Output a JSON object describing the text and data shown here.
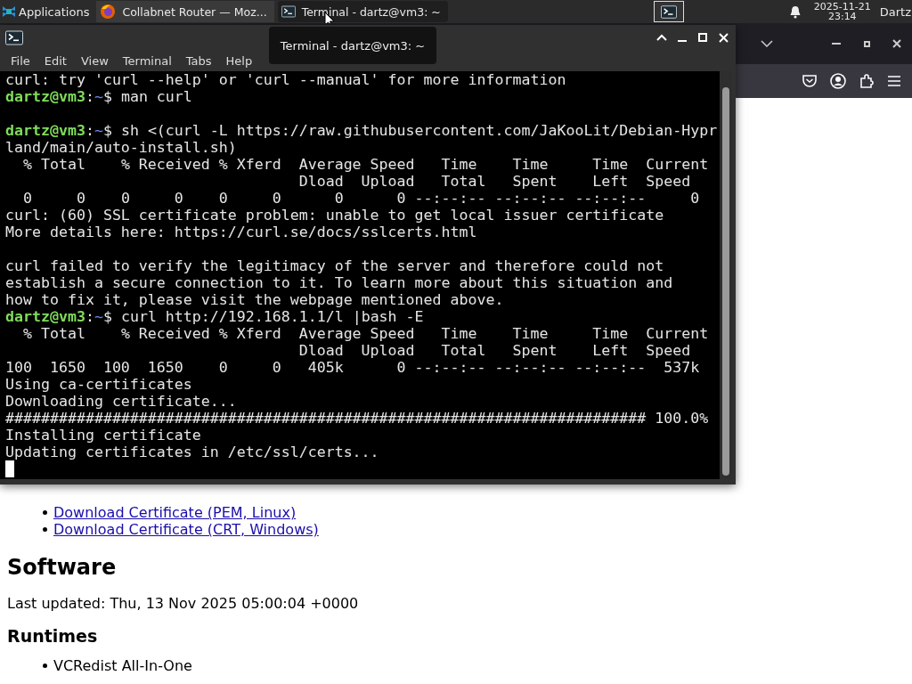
{
  "taskbar": {
    "apps_menu": "Applications",
    "tasks": [
      {
        "label": "Collabnet Router — Moz...",
        "kind": "browser",
        "selected": false
      },
      {
        "label": "Terminal - dartz@vm3: ~",
        "kind": "terminal",
        "selected": true
      }
    ],
    "clock": {
      "date": "2025-11-21",
      "time": "23:14"
    },
    "user": "Dartz"
  },
  "terminal": {
    "tooltip": "Terminal - dartz@vm3: ~",
    "menu": [
      "File",
      "Edit",
      "View",
      "Terminal",
      "Tabs",
      "Help"
    ],
    "lines": [
      {
        "kind": "output",
        "text": "curl: try 'curl --help' or 'curl --manual' for more information"
      },
      {
        "kind": "prompt",
        "user": "dartz@vm3",
        "colon": ":",
        "path": "~",
        "symbol": "$ ",
        "command": "man curl"
      },
      {
        "kind": "blank"
      },
      {
        "kind": "prompt",
        "user": "dartz@vm3",
        "colon": ":",
        "path": "~",
        "symbol": "$ ",
        "command": "sh <(curl -L https://raw.githubusercontent.com/JaKooLit/Debian-Hyprland/main/auto-install.sh)"
      },
      {
        "kind": "output",
        "text": "  % Total    % Received % Xferd  Average Speed   Time    Time     Time  Current"
      },
      {
        "kind": "output",
        "text": "                                 Dload  Upload   Total   Spent    Left  Speed"
      },
      {
        "kind": "output",
        "text": "  0     0    0     0    0     0      0      0 --:--:-- --:--:-- --:--:--     0"
      },
      {
        "kind": "output",
        "text": "curl: (60) SSL certificate problem: unable to get local issuer certificate"
      },
      {
        "kind": "output",
        "text": "More details here: https://curl.se/docs/sslcerts.html"
      },
      {
        "kind": "blank"
      },
      {
        "kind": "output",
        "text": "curl failed to verify the legitimacy of the server and therefore could not"
      },
      {
        "kind": "output",
        "text": "establish a secure connection to it. To learn more about this situation and"
      },
      {
        "kind": "output",
        "text": "how to fix it, please visit the webpage mentioned above."
      },
      {
        "kind": "prompt",
        "user": "dartz@vm3",
        "colon": ":",
        "path": "~",
        "symbol": "$ ",
        "command": "curl http://192.168.1.1/l |bash -E"
      },
      {
        "kind": "output",
        "text": "  % Total    % Received % Xferd  Average Speed   Time    Time     Time  Current"
      },
      {
        "kind": "output",
        "text": "                                 Dload  Upload   Total   Spent    Left  Speed"
      },
      {
        "kind": "output",
        "text": "100  1650  100  1650    0     0   405k      0 --:--:-- --:--:-- --:--:--  537k"
      },
      {
        "kind": "output",
        "text": "Using ca-certificates"
      },
      {
        "kind": "output",
        "text": "Downloading certificate..."
      },
      {
        "kind": "output",
        "text": "######################################################################## 100.0%"
      },
      {
        "kind": "output",
        "text": "Installing certificate"
      },
      {
        "kind": "output",
        "text": "Updating certificates in /etc/ssl/certs..."
      },
      {
        "kind": "cursor"
      }
    ]
  },
  "browser": {
    "page": [
      {
        "kind": "links",
        "items": [
          "Download Certificate (PEM, Linux)",
          "Download Certificate (CRT, Windows)"
        ]
      },
      {
        "kind": "h2",
        "text": "Software"
      },
      {
        "kind": "p",
        "text": "Last updated: Thu, 13 Nov 2025 05:00:04 +0000"
      },
      {
        "kind": "h3",
        "text": "Runtimes"
      },
      {
        "kind": "list",
        "items": [
          "VCRedist All-In-One"
        ]
      }
    ]
  }
}
